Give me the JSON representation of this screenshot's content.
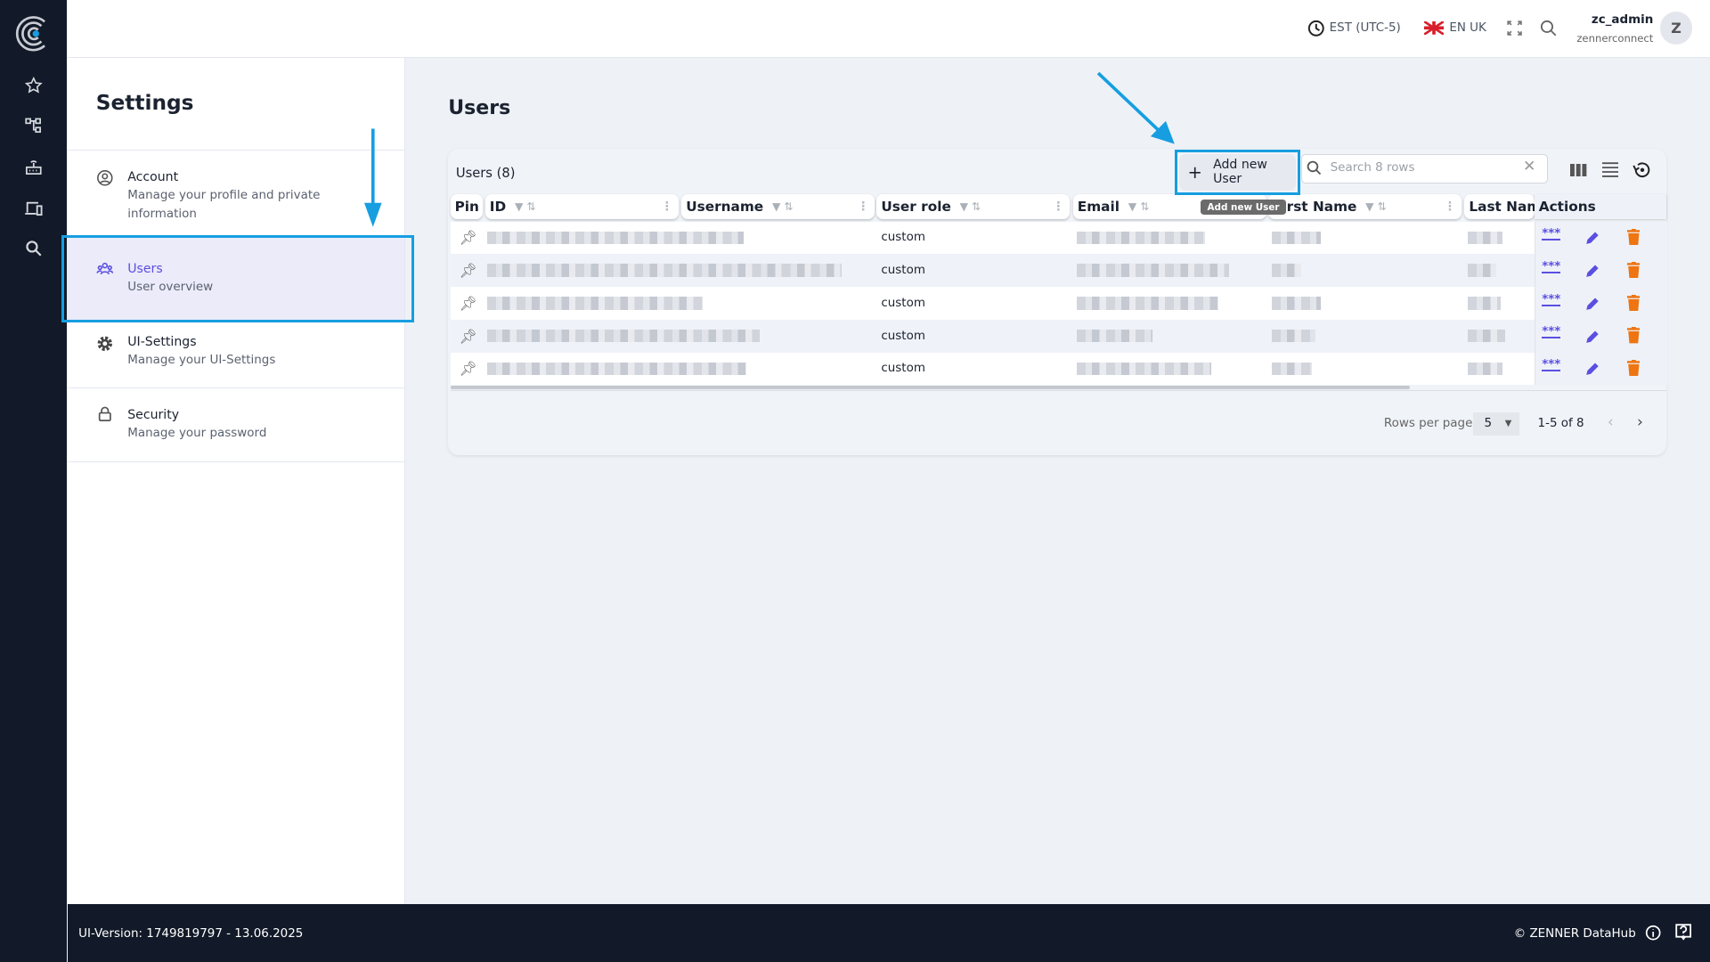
{
  "header": {
    "timezone": "EST (UTC-5)",
    "language": "EN UK",
    "user_name": "zc_admin",
    "user_org": "zennerconnect",
    "avatar_letter": "Z"
  },
  "rail": {
    "icons": [
      "logo-icon",
      "star-icon",
      "hierarchy-icon",
      "gateway-icon",
      "devices-icon",
      "search-icon"
    ]
  },
  "settings": {
    "title": "Settings",
    "items": [
      {
        "label": "Account",
        "sub": "Manage your profile and private information",
        "icon": "account-icon"
      },
      {
        "label": "Users",
        "sub": "User overview",
        "icon": "users-icon",
        "active": true
      },
      {
        "label": "UI-Settings",
        "sub": "Manage your UI-Settings",
        "icon": "gear-icon"
      },
      {
        "label": "Security",
        "sub": "Manage your password",
        "icon": "lock-icon"
      }
    ]
  },
  "main": {
    "title": "Users",
    "table": {
      "caption": "Users (8)",
      "add_label": "Add new User",
      "tooltip": "Add new User",
      "search_placeholder": "Search 8 rows",
      "columns": [
        "Pin",
        "ID",
        "Username",
        "User role",
        "Email",
        "First Name",
        "Last Name",
        "Actions"
      ],
      "rows": [
        {
          "role": "custom"
        },
        {
          "role": "custom"
        },
        {
          "role": "custom"
        },
        {
          "role": "custom"
        },
        {
          "role": "custom"
        }
      ],
      "rows_per_page_label": "Rows per page",
      "rows_per_page": "5",
      "range": "1-5 of 8"
    }
  },
  "footer": {
    "version": "UI-Version: 1749819797 - 13.06.2025",
    "brand": "© ZENNER DataHub"
  },
  "colors": {
    "rail": "#121a29",
    "accent": "#5b4fe0",
    "delete": "#ee7512",
    "annotation": "#169ee0",
    "active_bg": "#ebebfa"
  }
}
